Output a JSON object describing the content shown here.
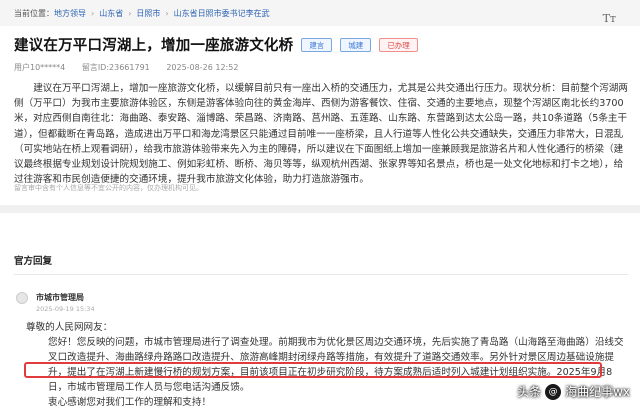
{
  "breadcrumb": {
    "current_label": "当前位置：",
    "items": [
      "地方领导",
      "山东省",
      "日照市",
      "山东省日照市委书记李在武"
    ]
  },
  "toolbar": {
    "font_icon": "Tт"
  },
  "post": {
    "title": "建议在万平口泻湖上，增加一座旅游文化桥",
    "tags": [
      "建言",
      "城建",
      "已办理"
    ],
    "meta": {
      "user": "用户10*****4",
      "post_id": "留言ID:23661791",
      "time": "2025-08-26 12:52"
    },
    "body": "建议在万平口泻湖上，增加一座旅游文化桥，以缓解目前只有一座出入桥的交通压力，尤其是公共交通出行压力。现状分析：目前整个泻湖两侧（万平口）为我市主要旅游体验区，东侧是游客体验向往的黄金海岸、西侧为游客餐饮、住宿、交通的主要地点，现整个泻湖区南北长约3700米，对应西侧自南往北：海曲路、泰安路、淄博路、荣昌路、济南路、莒州路、五莲路、山东路、东营路到达太公岛一路，共10条道路（5条主干道），但都截断在青岛路，造成进出万平口和海龙湾景区只能通过目前唯一一座桥梁，且人行道等人性化公共交通缺失，交通压力非常大，日混乱（可实地站在桥上观看调研），给我市旅游体验带来先入为主的障碍，所以建议在下面图纸上增加一座兼顾我是旅游名片和人性化通行的桥梁（建议最终根据专业规划设计院规划施工、例如彩虹桥、断桥、海贝等等，纵观杭州西湖、张家界等知名景点，桥也是一处文化地标和打卡之地），给过往游客和市民创造便捷的交通环境，提升我市旅游文化体验，助力打造旅游强市。",
    "note": "留言审中含有个人信息等不宜公开的内容，仅办理机构可见。"
  },
  "reply": {
    "header": "官方回复",
    "department": "市城市管理局",
    "date": "2025-09-19 15:34",
    "greeting": "尊敬的人民网网友：",
    "body": "您好！您反映的问题，市城市管理局进行了调查处理。前期我市为优化景区周边交通环境，先后实施了青岛路（山海路至海曲路）沿线交叉口改造提升、海曲路绿舟路路口改造提升、旅游高峰期封闭绿舟路等措施，有效提升了道路交通效率。另外针对景区周边基础设施提升，提出了在泻湖上新建慢行桥的规划方案，目前该项目正在初步研究阶段，待方案成熟后适时列入城建计划组织实施。2025年9月8日，市城市管理局工作人员与您电话沟通反馈。",
    "thanks": "衷心感谢您对我们工作的理解和支持！"
  },
  "watermark": {
    "prefix": "头条",
    "logo": "@",
    "name": "海曲纪事wx"
  }
}
